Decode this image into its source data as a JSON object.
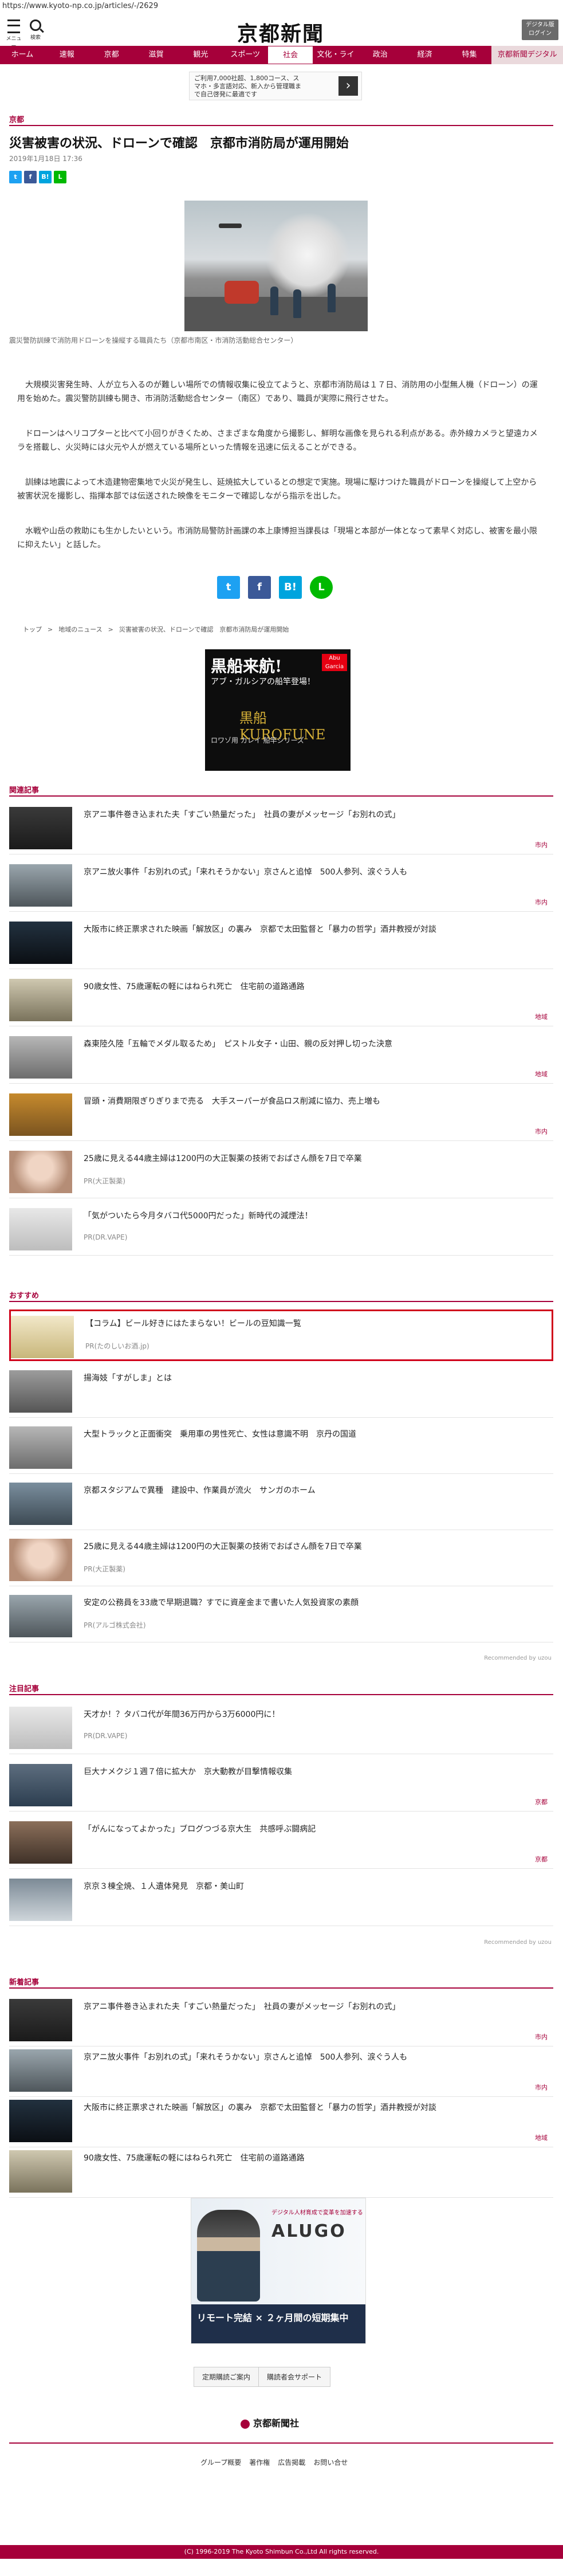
{
  "browser": {
    "url": "https://www.kyoto-np.co.jp/articles/-/2629"
  },
  "header": {
    "menu_label": "メニュー",
    "search_label": "検索",
    "logo": "京都新聞",
    "digital_button": "デジタル版\nログイン"
  },
  "nav": [
    "ホーム",
    "速報",
    "京都",
    "滋賀",
    "観光",
    "スポーツ",
    "社会",
    "文化・ライフ",
    "政治",
    "経済",
    "特集",
    "京都新聞デジタル"
  ],
  "promo": {
    "lines": [
      "ご利用7,000社超、1,800コース、ス",
      "マホ・多言語対応、新入から管理職ま",
      "で自己啓発に最適です"
    ]
  },
  "article": {
    "section": "京都",
    "headline": "災害被害の状況、ドローンで確認　京都市消防局が運用開始",
    "date": "2019年1月18日 17:36",
    "caption": "震災警防訓練で消防用ドローンを操縦する職員たち（京都市南区・市消防活動総合センター）",
    "paragraphs": [
      "　大規模災害発生時、人が立ち入るのが難しい場所での情報収集に役立てようと、京都市消防局は１７日、消防用の小型無人機（ドローン）の運用を始めた。震災警防訓練も開き、市消防活動総合センター（南区）であり、職員が実際に飛行させた。",
      "　ドローンはヘリコプターと比べて小回りがきくため、さまざまな角度から撮影し、鮮明な画像を見られる利点がある。赤外線カメラと望遠カメラを搭載し、火災時には火元や人が燃えている場所といった情報を迅速に伝えることができる。",
      "　訓練は地震によって木造建物密集地で火災が発生し、延焼拡大しているとの想定で実施。現場に駆けつけた職員がドローンを操縦して上空から被害状況を撮影し、指揮本部では伝送された映像をモニターで確認しながら指示を出した。",
      "　水戦や山岳の救助にも生かしたいという。市消防局警防計画課の本上康博担当課長は「現場と本部が一体となって素早く対応し、被害を最小限に抑えたい」と話した。"
    ]
  },
  "share": {
    "twitter": "t",
    "facebook": "f",
    "hatena": "B!",
    "line": "LINE"
  },
  "breadcrumb": [
    "トップ",
    ">",
    "地域のニュース",
    ">",
    "災害被害の状況、ドローンで確認　京都市消防局が運用開始"
  ],
  "ad_top": {
    "headline": "黒船来航!",
    "subline": "アブ・ガルシアの船竿登場！",
    "brand": "黒船 KUROFUNE",
    "badge": "Abu Garcia",
    "tagline": "ロワゾ用 カレイ 船竿シリーズ"
  },
  "related": {
    "label": "関連記事",
    "items": [
      {
        "title": "京アニ事件巻き込まれた夫「すごい熱量だった」　社員の妻がメッセージ「お別れの式」",
        "cat": "市内",
        "thumb": "t-dark"
      },
      {
        "title": "京アニ放火事件「お別れの式」「来れそうかない」京さんと追悼　500人参列、涙ぐう人も",
        "cat": "市内",
        "thumb": "t-photo1"
      },
      {
        "title": "大阪市に終正票求された映画「解放区」の裏み　京都で太田監督と「暴力の哲学」酒井教授が対談",
        "cat": "",
        "thumb": "t-night"
      },
      {
        "title": "90歳女性、75歳運転の軽にはねられ死亡　住宅前の道路通路",
        "cat": "地域",
        "thumb": "t-bldg"
      },
      {
        "title": "森東陸久陸「五輪でメダル取るため」　ピストル女子・山田、親の反対押し切った決意",
        "cat": "地域",
        "thumb": "t-street"
      },
      {
        "title": "冒頭・消費期限ぎりぎりまで売る　大手スーパーが食品ロス削減に協力、売上増も",
        "cat": "市内",
        "thumb": "t-shop"
      },
      {
        "title": "25歳に見える44歳主婦は1200円の大正製薬の技術でおばさん顔を7日で卒業",
        "cat": "",
        "pr": "PR(大正製薬)",
        "thumb": "t-face"
      },
      {
        "title": "「気がついたら今月タバコ代5000円だった」新時代の減煙法！",
        "cat": "",
        "pr": "PR(DR.VAPE)",
        "thumb": "t-phone"
      }
    ]
  },
  "recommend": {
    "label": "おすすめ",
    "items": [
      {
        "title": "【コラム】ビール好きにはたまらない！ビールの豆知識一覧",
        "pr": "PR(たのしいお酒.jp)",
        "thumb": "t-beer",
        "highlight": true
      },
      {
        "title": "揚海妓「すがしま」とは",
        "thumb": "t-car"
      },
      {
        "title": "大型トラックと正面衝突　乗用車の男性死亡、女性は意識不明　京丹の国道",
        "thumb": "t-street"
      },
      {
        "title": "京都スタジアムで異種　建設中、作業員が流火　サンガのホーム",
        "thumb": "t-stadium"
      },
      {
        "title": "25歳に見える44歳主婦は1200円の大正製薬の技術でおばさん顔を7日で卒業",
        "pr": "PR(大正製薬)",
        "thumb": "t-face"
      },
      {
        "title": "安定の公務員を33歳で早期退職？すでに資産金まで書いた人気投資家の素顔",
        "pr": "PR(アルゴ株式会社)",
        "thumb": "t-photo1"
      }
    ],
    "credit": "Recommended by uzou"
  },
  "notable": {
    "label": "注目記事",
    "items": [
      {
        "title": "天才か！？タバコ代が年間36万円から3万6000円に！",
        "pr": "PR(DR.VAPE)",
        "thumb": "t-phone"
      },
      {
        "title": "巨大ナメクジ１週７倍に拡大か　京大動教が目撃情報収集",
        "cat": "京都",
        "thumb": "t-tv"
      },
      {
        "title": "「がんになってよかった」ブログつづる京大生　共感呼ぶ闘病記",
        "cat": "京都",
        "thumb": "t-crowd"
      },
      {
        "title": "京京３棟全焼、１人遺体発見　京都・美山町",
        "cat": "",
        "thumb": "t-fire"
      }
    ],
    "credit": "Recommended by uzou"
  },
  "latest": {
    "label": "新着記事",
    "items": [
      {
        "title": "京アニ事件巻き込まれた夫「すごい熱量だった」　社員の妻がメッセージ「お別れの式」",
        "cat": "市内",
        "thumb": "t-dark"
      },
      {
        "title": "京アニ放火事件「お別れの式」「来れそうかない」京さんと追悼　500人参列、涙ぐう人も",
        "cat": "市内",
        "thumb": "t-photo1"
      },
      {
        "title": "大阪市に終正票求された映画「解放区」の裏み　京都で太田監督と「暴力の哲学」酒井教授が対談",
        "cat": "地域",
        "thumb": "t-night"
      },
      {
        "title": "90歳女性、75歳運転の軽にはねられ死亡　住宅前の道路通路",
        "cat": "",
        "thumb": "t-bldg"
      }
    ]
  },
  "ad_bottom": {
    "small": "デジタル人材育成で変革を加速する",
    "brand": "ALUGO",
    "line1": "リモート完結 × ２ヶ月間の短期集中",
    "line2a": "リモート完結",
    "line2b": "２ヶ月間の短期集中"
  },
  "footer": {
    "buttons": [
      "定期購読ご案内",
      "購読者会サポート"
    ],
    "logo": "京都新聞社",
    "links": [
      "グループ概要",
      "著作権",
      "広告掲載",
      "お問い合せ"
    ],
    "copyright": "(C) 1996-2019 The Kyoto Shimbun Co.,Ltd All rights reserved."
  }
}
